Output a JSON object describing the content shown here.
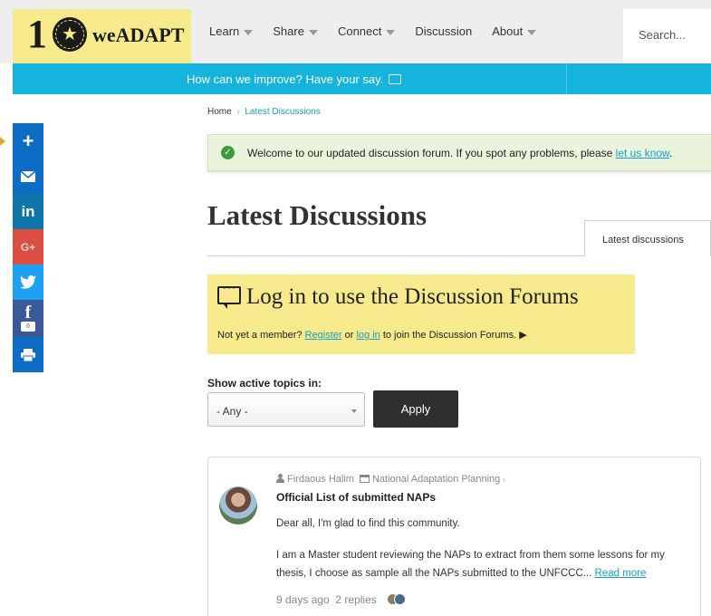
{
  "header": {
    "logo_number": "1",
    "logo_text": "weADAPT",
    "nav": [
      {
        "label": "Learn",
        "dropdown": true
      },
      {
        "label": "Share",
        "dropdown": true
      },
      {
        "label": "Connect",
        "dropdown": true
      },
      {
        "label": "Discussion",
        "dropdown": false
      },
      {
        "label": "About",
        "dropdown": true
      }
    ],
    "search_placeholder": "Search..."
  },
  "banner": {
    "text": "How can we improve? Have your say."
  },
  "share_bar": {
    "buttons": [
      {
        "name": "share-plus-button",
        "icon": "plus-icon",
        "glyph": "+",
        "color": "#0d6cc3"
      },
      {
        "name": "share-email-button",
        "icon": "envelope-icon",
        "glyph": "✉",
        "color": "#0d6cc3"
      },
      {
        "name": "share-linkedin-button",
        "icon": "linkedin-icon",
        "glyph": "in",
        "color": "#0e76a8"
      },
      {
        "name": "share-google-plus-button",
        "icon": "google-plus-icon",
        "glyph": "G+",
        "color": "#dc4e41"
      },
      {
        "name": "share-twitter-button",
        "icon": "twitter-icon",
        "glyph": "🐦",
        "color": "#1da1f2"
      },
      {
        "name": "share-facebook-button",
        "icon": "facebook-icon",
        "glyph": "f",
        "color": "#3b5998"
      },
      {
        "name": "share-print-button",
        "icon": "printer-icon",
        "glyph": "🖶",
        "color": "#0d6cc3"
      }
    ],
    "facebook_count": "0"
  },
  "breadcrumb": {
    "home": "Home",
    "current": "Latest Discussions"
  },
  "welcome": {
    "text": "Welcome to our updated discussion forum. If you spot any problems, please ",
    "link": "let us know",
    "suffix": "."
  },
  "page_title": "Latest Discussions",
  "tab_label": "Latest discussions",
  "login": {
    "heading": "Log in to use the Discussion Forums",
    "prefix": "Not yet a member? ",
    "register": "Register",
    "or": " or ",
    "login_link": "log in",
    "suffix": " to join the Discussion Forums. ▶"
  },
  "filter": {
    "label": "Show active topics in:",
    "selected": "- Any -",
    "apply": "Apply"
  },
  "topic": {
    "author": "Firdaous Halim",
    "forum": "National Adaptation Planning",
    "title": "Official List of submitted NAPs",
    "excerpt_1": "Dear all, I'm glad to find this community.",
    "excerpt_2": "I am a Master student reviewing the NAPs to extract from them some lessons for my thesis, I choose as sample all the NAPs submitted to the UNFCCC... ",
    "read_more": "Read more",
    "age": "9 days ago",
    "replies": "2 replies"
  },
  "colors": {
    "brand_yellow": "#f6ea8c",
    "banner_cyan": "#14b4dc",
    "link": "#14a0c8",
    "success_bg": "#eaf4dd"
  }
}
